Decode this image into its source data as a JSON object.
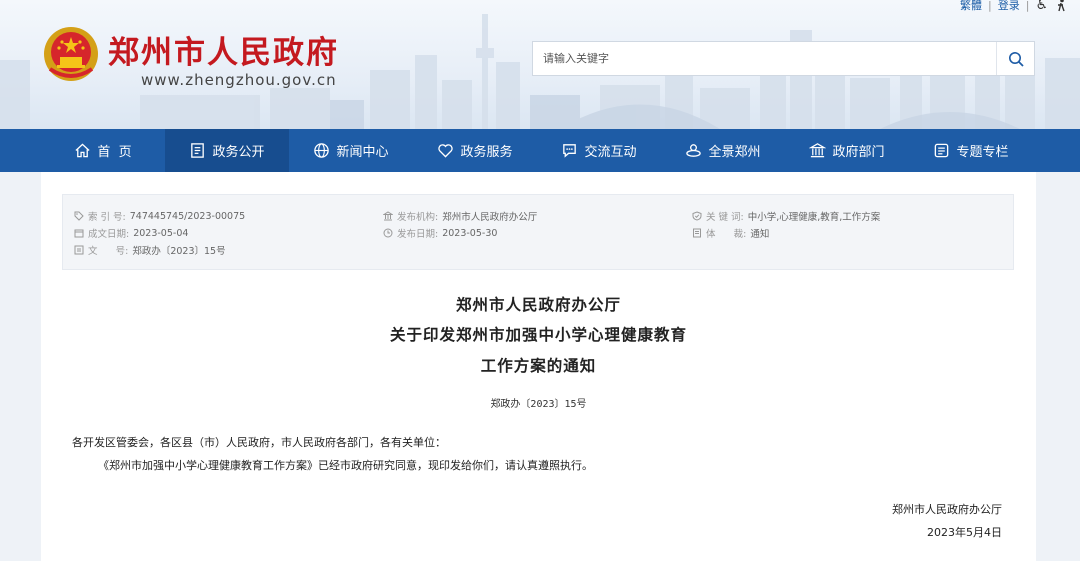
{
  "header": {
    "top_links": [
      "繁體",
      "登录"
    ],
    "site_title": "郑州市人民政府",
    "site_url": "www.zhengzhou.gov.cn",
    "search_placeholder": "请输入关键字",
    "colors": {
      "title_red": "#c4191f",
      "nav_blue": "#1e5ca6",
      "nav_active": "#174d8f"
    }
  },
  "nav": {
    "items": [
      {
        "label": "首  页",
        "icon": "home-icon"
      },
      {
        "label": "政务公开",
        "icon": "document-icon",
        "active": true
      },
      {
        "label": "新闻中心",
        "icon": "globe-icon"
      },
      {
        "label": "政务服务",
        "icon": "heart-icon"
      },
      {
        "label": "交流互动",
        "icon": "chat-icon"
      },
      {
        "label": "全景郑州",
        "icon": "panorama-icon"
      },
      {
        "label": "政府部门",
        "icon": "building-icon"
      },
      {
        "label": "专题专栏",
        "icon": "list-icon"
      }
    ]
  },
  "meta": {
    "index_label": "索 引 号:",
    "index_value": "747445745/2023-00075",
    "created_label": "成文日期:",
    "created_value": "2023-05-04",
    "docno_label": "文      号:",
    "docno_value": "郑政办〔2023〕15号",
    "issuer_label": "发布机构:",
    "issuer_value": "郑州市人民政府办公厅",
    "published_label": "发布日期:",
    "published_value": "2023-05-30",
    "keywords_label": "关 键 词:",
    "keywords_value": "中小学,心理健康,教育,工作方案",
    "genre_label": "体      裁:",
    "genre_value": "通知"
  },
  "document": {
    "title_lines": [
      "郑州市人民政府办公厅",
      "关于印发郑州市加强中小学心理健康教育",
      "工作方案的通知"
    ],
    "number": "郑政办〔2023〕15号",
    "salutation": "各开发区管委会，各区县（市）人民政府，市人民政府各部门，各有关单位：",
    "body": "《郑州市加强中小学心理健康教育工作方案》已经市政府研究同意，现印发给你们，请认真遵照执行。",
    "signature": "郑州市人民政府办公厅",
    "date": "2023年5月4日"
  }
}
